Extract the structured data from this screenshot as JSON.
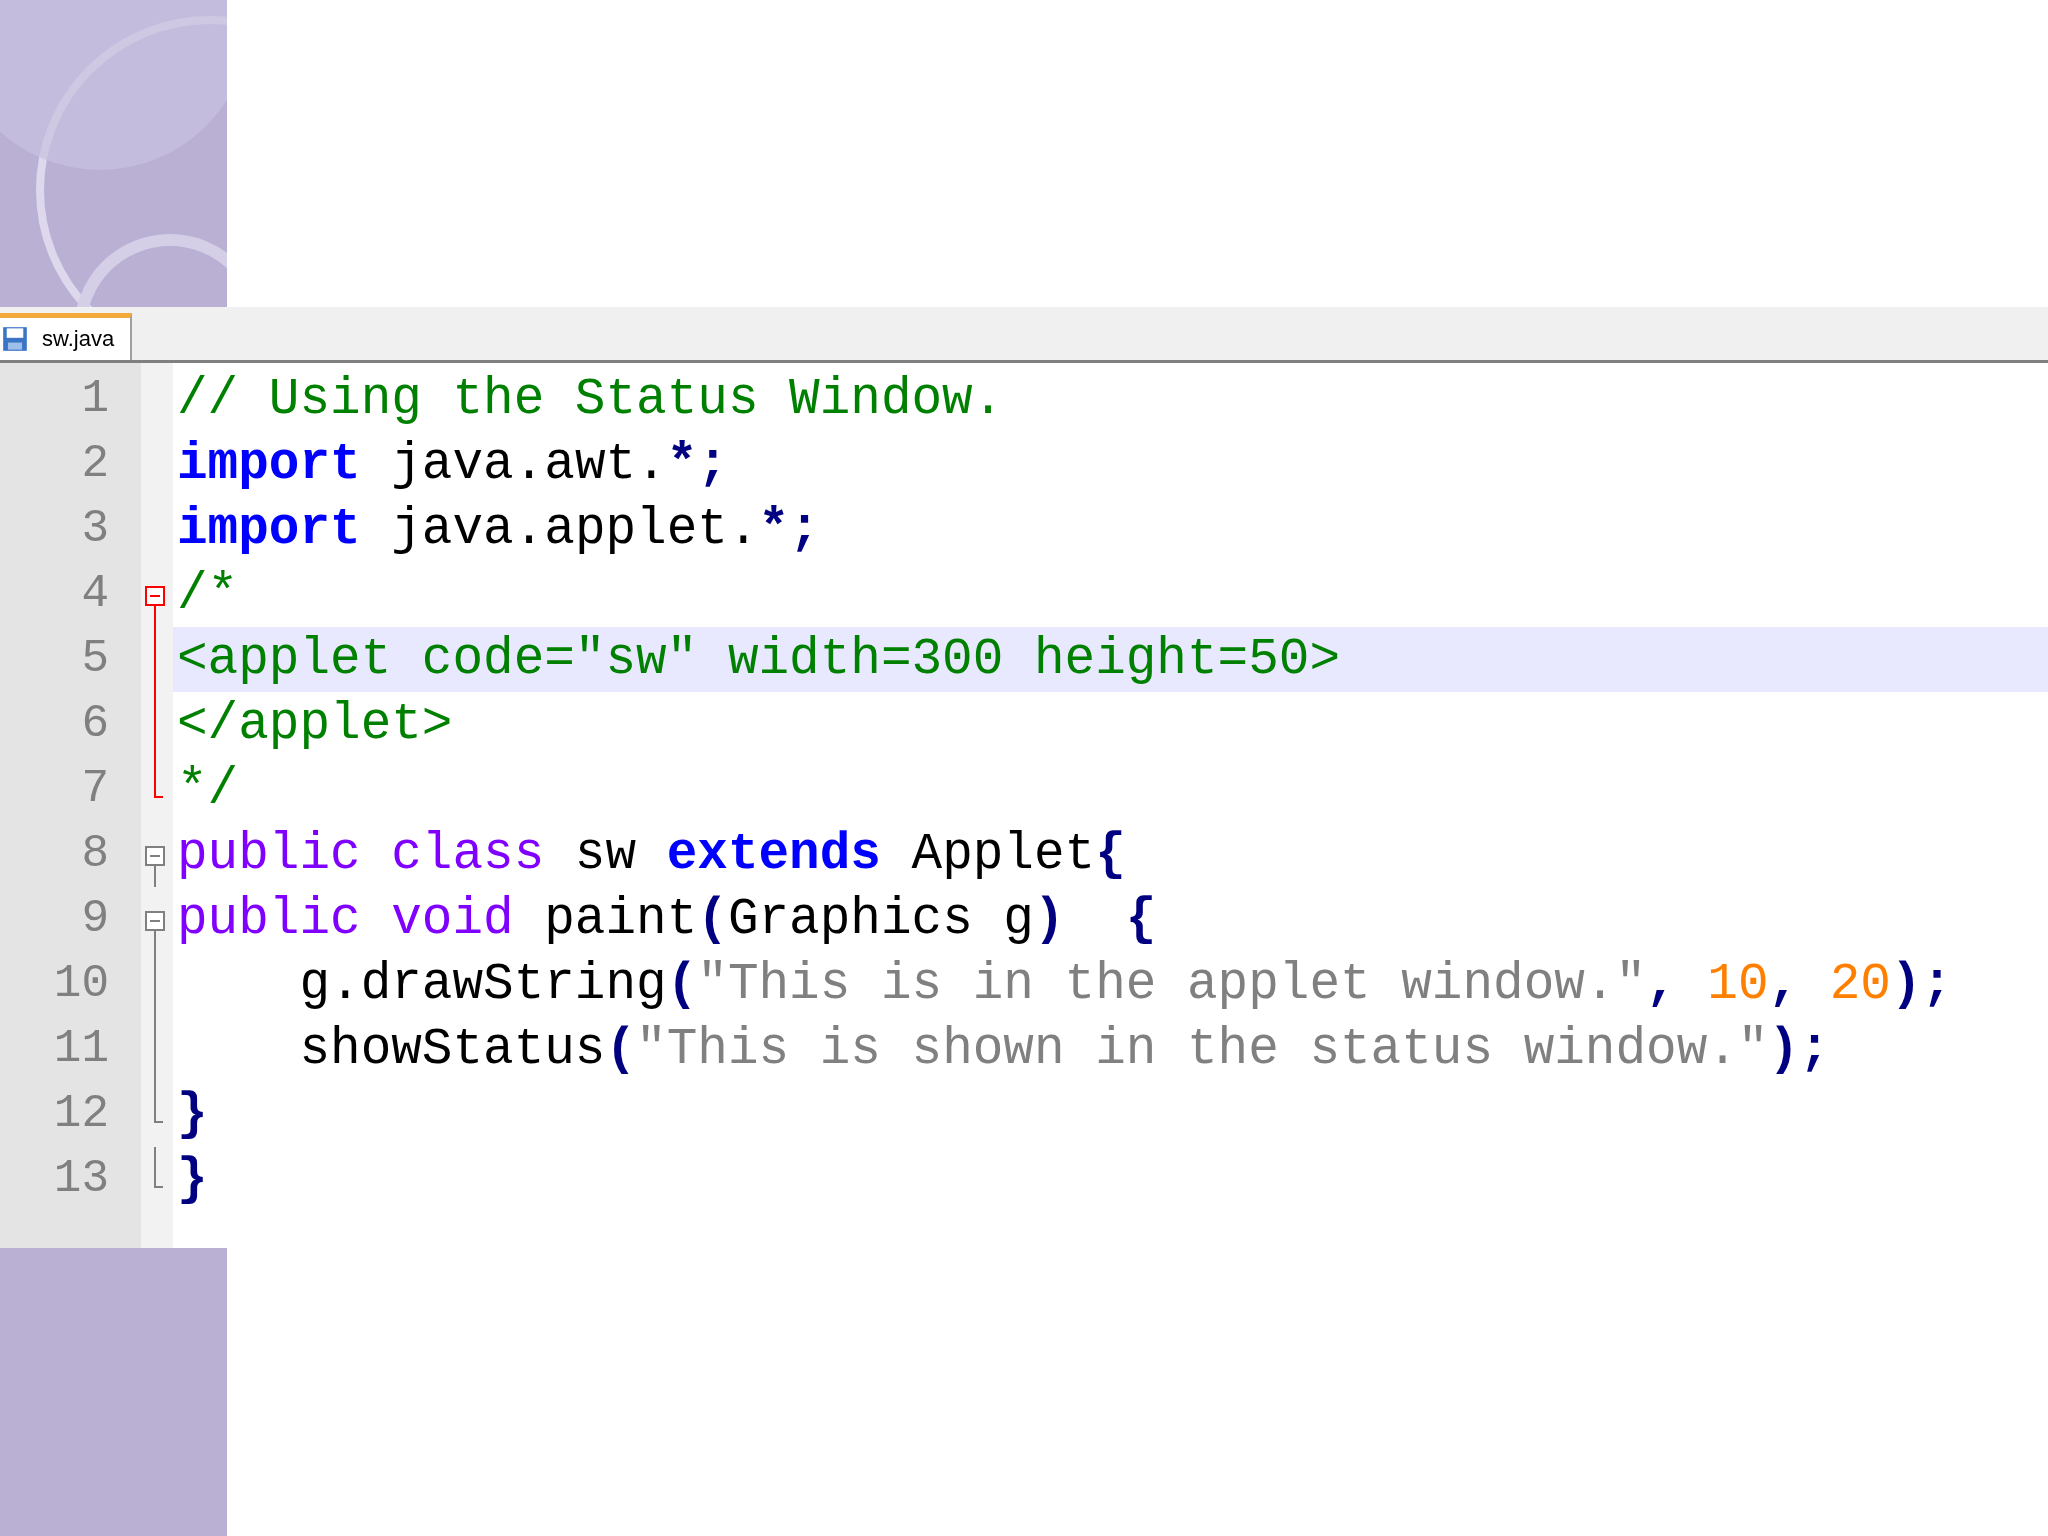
{
  "tabs": [
    {
      "label": "sw.java",
      "selected": true
    }
  ],
  "lines": [
    {
      "number": "1",
      "current": false,
      "tokens": [
        {
          "kind": "comment",
          "text": "// Using the Status Window."
        }
      ]
    },
    {
      "number": "2",
      "current": false,
      "tokens": [
        {
          "kind": "keyword",
          "text": "import"
        },
        {
          "kind": "plain",
          "text": " java.awt."
        },
        {
          "kind": "operator",
          "text": "*;"
        }
      ]
    },
    {
      "number": "3",
      "current": false,
      "tokens": [
        {
          "kind": "keyword",
          "text": "import"
        },
        {
          "kind": "plain",
          "text": " java.applet."
        },
        {
          "kind": "operator",
          "text": "*;"
        }
      ]
    },
    {
      "number": "4",
      "current": false,
      "fold": {
        "kind": "open",
        "color": "#ff0000"
      },
      "tokens": [
        {
          "kind": "comment",
          "text": "/*"
        }
      ]
    },
    {
      "number": "5",
      "current": true,
      "fold": {
        "kind": "line",
        "color": "#ff0000"
      },
      "tokens": [
        {
          "kind": "comment",
          "text": "<applet code=\"sw\" width=300 height=50>"
        }
      ]
    },
    {
      "number": "6",
      "current": false,
      "fold": {
        "kind": "line",
        "color": "#ff0000"
      },
      "tokens": [
        {
          "kind": "comment",
          "text": "</applet>"
        }
      ]
    },
    {
      "number": "7",
      "current": false,
      "fold": {
        "kind": "end",
        "color": "#ff0000"
      },
      "tokens": [
        {
          "kind": "comment",
          "text": "*/"
        }
      ]
    },
    {
      "number": "8",
      "current": false,
      "fold": {
        "kind": "open",
        "color": "#808080"
      },
      "tokens": [
        {
          "kind": "type",
          "text": "public class"
        },
        {
          "kind": "plain",
          "text": " sw "
        },
        {
          "kind": "keyword",
          "text": "extends"
        },
        {
          "kind": "plain",
          "text": " Applet"
        },
        {
          "kind": "operator",
          "text": "{"
        }
      ]
    },
    {
      "number": "9",
      "current": false,
      "fold": {
        "kind": "open",
        "color": "#808080"
      },
      "tokens": [
        {
          "kind": "type",
          "text": "public void"
        },
        {
          "kind": "plain",
          "text": " paint"
        },
        {
          "kind": "operator",
          "text": "("
        },
        {
          "kind": "plain",
          "text": "Graphics g"
        },
        {
          "kind": "operator",
          "text": ")  {"
        }
      ]
    },
    {
      "number": "10",
      "current": false,
      "fold": {
        "kind": "line",
        "color": "#808080"
      },
      "tokens": [
        {
          "kind": "plain",
          "text": "    g.drawString"
        },
        {
          "kind": "operator",
          "text": "("
        },
        {
          "kind": "string",
          "text": "\"This is in the applet window.\""
        },
        {
          "kind": "operator",
          "text": ", "
        },
        {
          "kind": "number",
          "text": "10"
        },
        {
          "kind": "operator",
          "text": ", "
        },
        {
          "kind": "number",
          "text": "20"
        },
        {
          "kind": "operator",
          "text": ");"
        }
      ]
    },
    {
      "number": "11",
      "current": false,
      "fold": {
        "kind": "line",
        "color": "#808080"
      },
      "tokens": [
        {
          "kind": "plain",
          "text": "    showStatus"
        },
        {
          "kind": "operator",
          "text": "("
        },
        {
          "kind": "string",
          "text": "\"This is shown in the status window.\""
        },
        {
          "kind": "operator",
          "text": ");"
        }
      ]
    },
    {
      "number": "12",
      "current": false,
      "fold": {
        "kind": "end",
        "color": "#808080"
      },
      "tokens": [
        {
          "kind": "operator",
          "text": "}"
        }
      ]
    },
    {
      "number": "13",
      "current": false,
      "fold": {
        "kind": "end",
        "color": "#808080"
      },
      "tokens": [
        {
          "kind": "operator",
          "text": "}"
        }
      ]
    }
  ]
}
